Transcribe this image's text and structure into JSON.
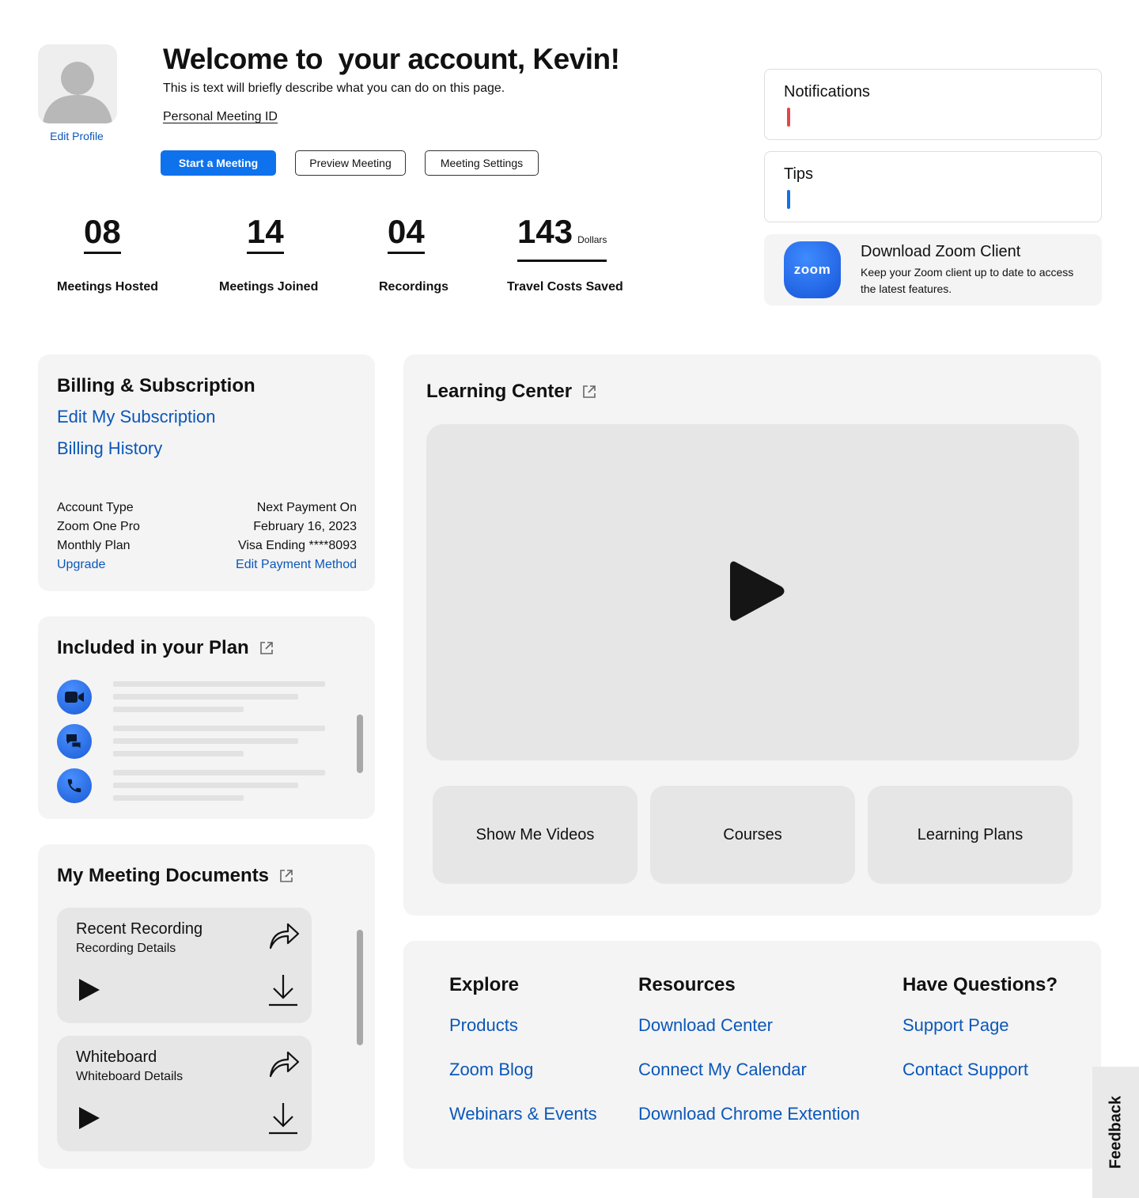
{
  "profile": {
    "edit_label": "Edit Profile",
    "welcome": "Welcome to  your account, Kevin!",
    "description": "This is text will briefly describe what you can do on this page.",
    "pmi_label": "Personal Meeting ID"
  },
  "actions": {
    "start": "Start a Meeting",
    "preview": "Preview Meeting",
    "settings": "Meeting Settings"
  },
  "stats": [
    {
      "value": "08",
      "unit": "",
      "label": "Meetings Hosted"
    },
    {
      "value": "14",
      "unit": "",
      "label": "Meetings Joined"
    },
    {
      "value": "04",
      "unit": "",
      "label": "Recordings"
    },
    {
      "value": "143",
      "unit": "Dollars",
      "label": "Travel Costs Saved"
    }
  ],
  "side": {
    "notifications": "Notifications",
    "tips": "Tips",
    "download_title": "Download Zoom Client",
    "download_text": "Keep your Zoom client up to date to access the latest features.",
    "logo_text": "zoom",
    "colors": {
      "notification_bar": "#e8434a",
      "tips_bar": "#0e72ed",
      "accent": "#0e72ed",
      "link": "#0b57b9"
    }
  },
  "billing": {
    "title": "Billing & Subscription",
    "edit_subscription": "Edit My Subscription",
    "history": "Billing History",
    "rows": [
      {
        "left": "Account Type",
        "right": "Next Payment On"
      },
      {
        "left": "Zoom One Pro",
        "right": "February 16, 2023"
      },
      {
        "left": "Monthly Plan",
        "right": "Visa Ending ****8093"
      }
    ],
    "upgrade": "Upgrade",
    "edit_payment": "Edit Payment Method"
  },
  "plan": {
    "title": "Included in your Plan",
    "icons": [
      "video-camera-icon",
      "chat-icon",
      "phone-icon"
    ]
  },
  "documents": {
    "title": "My Meeting Documents",
    "items": [
      {
        "title": "Recent Recording",
        "detail": "Recording Details"
      },
      {
        "title": "Whiteboard",
        "detail": "Whiteboard Details"
      }
    ]
  },
  "learning": {
    "title": "Learning Center",
    "buttons": [
      "Show Me Videos",
      "Courses",
      "Learning Plans"
    ]
  },
  "footer": {
    "explore": {
      "heading": "Explore",
      "links": [
        "Products",
        "Zoom Blog",
        "Webinars & Events"
      ]
    },
    "resources": {
      "heading": "Resources",
      "links": [
        "Download Center",
        "Connect My Calendar",
        "Download Chrome Extention"
      ]
    },
    "questions": {
      "heading": "Have Questions?",
      "links": [
        "Support Page",
        "Contact Support"
      ]
    }
  },
  "feedback": "Feedback"
}
